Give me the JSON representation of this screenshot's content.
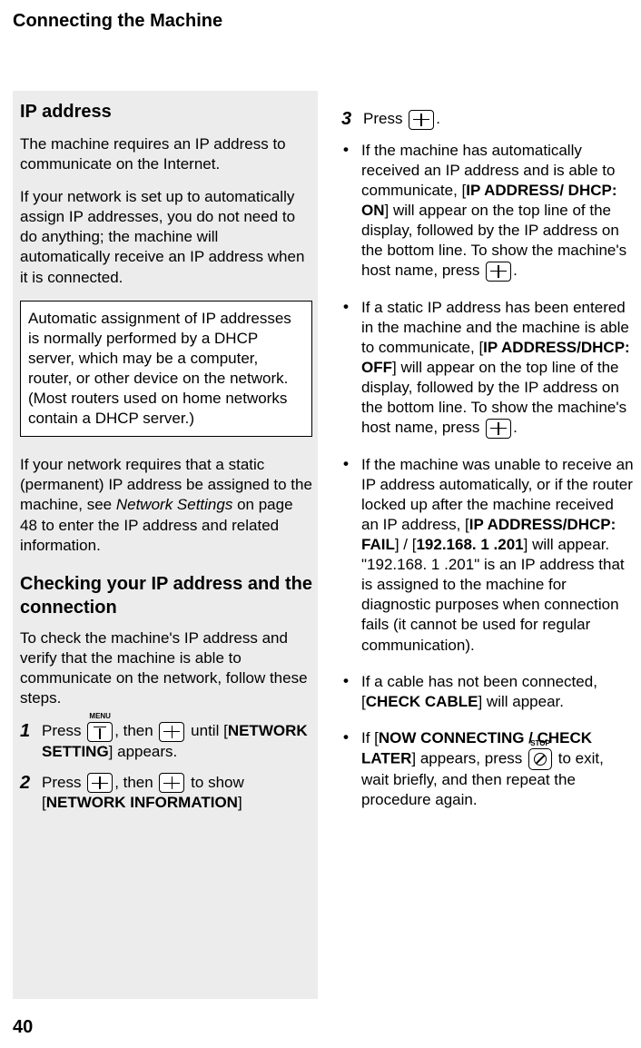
{
  "page": {
    "title": "Connecting the Machine",
    "number": "40"
  },
  "left": {
    "heading": "IP address",
    "p1": "The machine requires an IP address to communicate on the Internet.",
    "p2": "If your network is set up to automatically assign IP addresses, you do not need to do anything; the machine will automatically receive an IP address when it is connected.",
    "note": "Automatic assignment of IP addresses is normally performed by a DHCP server, which may be a computer, router, or other device on the network. (Most routers used on home networks contain a DHCP server.)",
    "p3a": "If your network requires that a static (permanent) IP address be assigned to the machine, see ",
    "p3ref": "Network Settings",
    "p3b": " on page 48 to enter the IP address and related information.",
    "subheading": "Checking your IP address and the connection",
    "p4": "To check the machine's IP address and verify that the machine is able to communicate on the network, follow these steps.",
    "step1a": "Press ",
    "step1b": ", then ",
    "step1c": " until [",
    "step1term": "NETWORK SETTING",
    "step1d": "] appears.",
    "step2a": "Press ",
    "step2b": ", then ",
    "step2c": " to show [",
    "step2term": "NETWORK INFORMATION",
    "step2d": "]"
  },
  "right": {
    "step3a": "Press ",
    "step3b": ".",
    "b1a": "If the machine has automatically received an IP address and is able to communicate, [",
    "b1term": "IP ADDRESS/ DHCP: ON",
    "b1b": "] will appear on the top line of the display, followed by the IP address on the bottom line. To show the machine's host name, press ",
    "b1c": ".",
    "b2a": "If a static IP address has been entered in the machine and the machine is able to communicate, [",
    "b2term": "IP ADDRESS/DHCP: OFF",
    "b2b": "] will appear on the top line of the display, followed by the IP address on the bottom line. To show the machine's host name, press ",
    "b2c": ".",
    "b3a": "If the machine was unable to receive an IP address automatically, or if the router locked up after the machine received an IP address, [",
    "b3term1": "IP ADDRESS/DHCP: FAIL",
    "b3b": "] / [",
    "b3term2": "192.168. 1 .201",
    "b3c": "] will appear. \"192.168. 1 .201\" is an IP address that is assigned to the machine for diagnostic purposes when connection fails (it cannot be used for regular communication).",
    "b4a": "If a cable has not been connected, [",
    "b4term": "CHECK CABLE",
    "b4b": "] will appear.",
    "b5a": "If [",
    "b5term": "NOW CONNECTING / CHECK LATER",
    "b5b": "] appears, press ",
    "b5c": " to exit, wait briefly, and then repeat the procedure again."
  },
  "labels": {
    "menu": "MENU",
    "stop": "STOP"
  }
}
